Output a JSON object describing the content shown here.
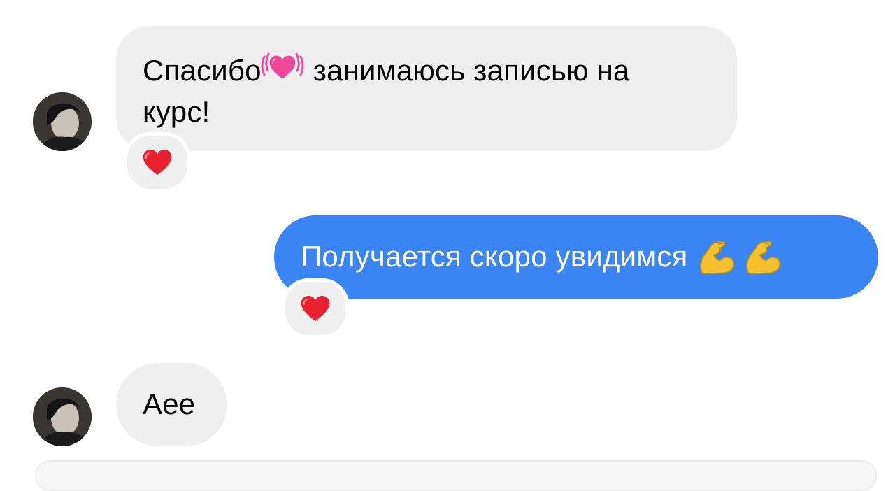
{
  "messages": [
    {
      "direction": "incoming",
      "text_before_emoji": "Спасибо",
      "emoji_icon": "beating-heart-icon",
      "text_after_emoji": " занимаюсь записью на",
      "text_line2": "курс!",
      "reaction_icon": "red-heart-icon"
    },
    {
      "direction": "outgoing",
      "text": "Получается скоро увидимся ",
      "emoji_icons": [
        "flexed-biceps-icon",
        "flexed-biceps-icon"
      ],
      "reaction_icon": "red-heart-icon"
    },
    {
      "direction": "incoming",
      "text": "Аее"
    }
  ],
  "colors": {
    "incoming_bubble": "#efefef",
    "outgoing_bubble": "#3a85f5",
    "reaction_heart": "#e8212f"
  }
}
